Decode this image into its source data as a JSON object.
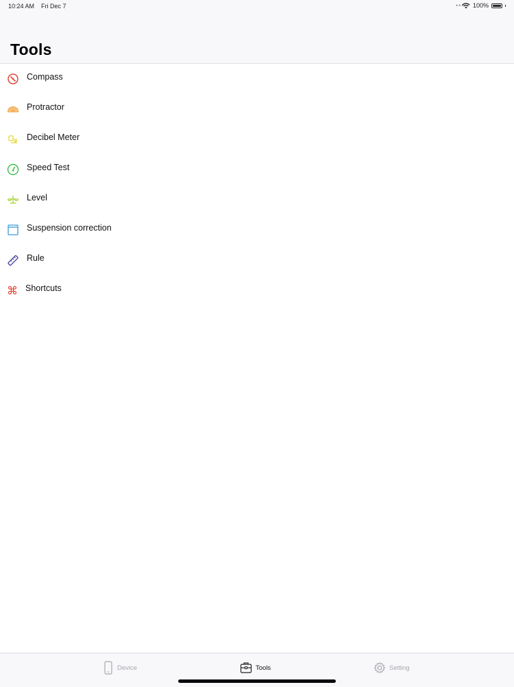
{
  "status_bar": {
    "time": "10:24 AM",
    "date": "Fri Dec 7",
    "battery": "100%"
  },
  "header": {
    "title": "Tools"
  },
  "tools": [
    {
      "label": "Compass",
      "icon": "compass-icon",
      "color": "#e0483a"
    },
    {
      "label": "Protractor",
      "icon": "protractor-icon",
      "color": "#f2a03d"
    },
    {
      "label": "Decibel Meter",
      "icon": "decibel-meter-icon",
      "color": "#e6d640"
    },
    {
      "label": "Speed Test",
      "icon": "speedometer-icon",
      "color": "#3cbf4a"
    },
    {
      "label": "Level",
      "icon": "level-icon",
      "color": "#a6cf2e"
    },
    {
      "label": "Suspension correction",
      "icon": "window-icon",
      "color": "#3a9ad9"
    },
    {
      "label": "Rule",
      "icon": "ruler-icon",
      "color": "#3f3f9a"
    },
    {
      "label": "Shortcuts",
      "icon": "command-icon",
      "color": "#e83b2a"
    }
  ],
  "tabbar": {
    "device": {
      "label": "Device",
      "icon": "phone-icon",
      "selected": false
    },
    "tools": {
      "label": "Tools",
      "icon": "toolbox-icon",
      "selected": true
    },
    "setting": {
      "label": "Setting",
      "icon": "gear-icon",
      "selected": false
    }
  }
}
